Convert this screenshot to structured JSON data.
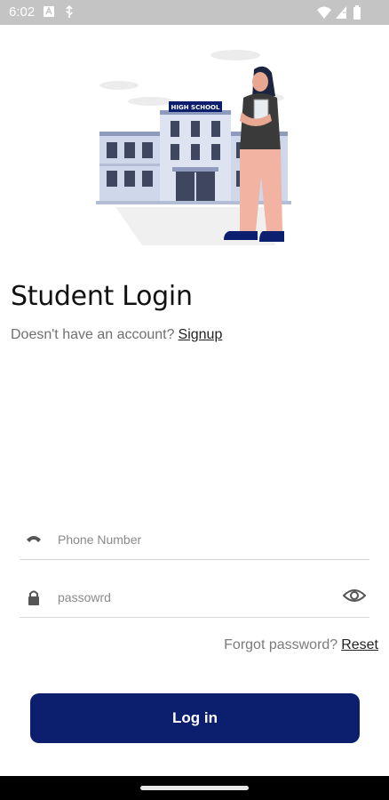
{
  "status_bar": {
    "time": "6:02",
    "icons": [
      "a11y-icon",
      "usb-icon",
      "wifi-icon",
      "signal-icon",
      "battery-icon"
    ]
  },
  "hero": {
    "sign_text": "HIGH SCHOOL",
    "colors": {
      "building": "#cfd8ea",
      "navy": "#0b1f6e",
      "skin": "#e8a790",
      "pants": "#f2b3a2",
      "shirt": "#3a3a3a"
    }
  },
  "login": {
    "title": "Student Login",
    "signup_prompt": "Doesn't have an account?",
    "signup_link": "Signup",
    "phone_placeholder": "Phone Number",
    "password_placeholder": "passowrd",
    "forgot_prompt": "Forgot password?",
    "reset_link": "Reset",
    "login_button": "Log in"
  },
  "colors": {
    "accent": "#0b1f6e",
    "status_bar": "#c4c4c4",
    "divider": "#d8d8d8"
  }
}
